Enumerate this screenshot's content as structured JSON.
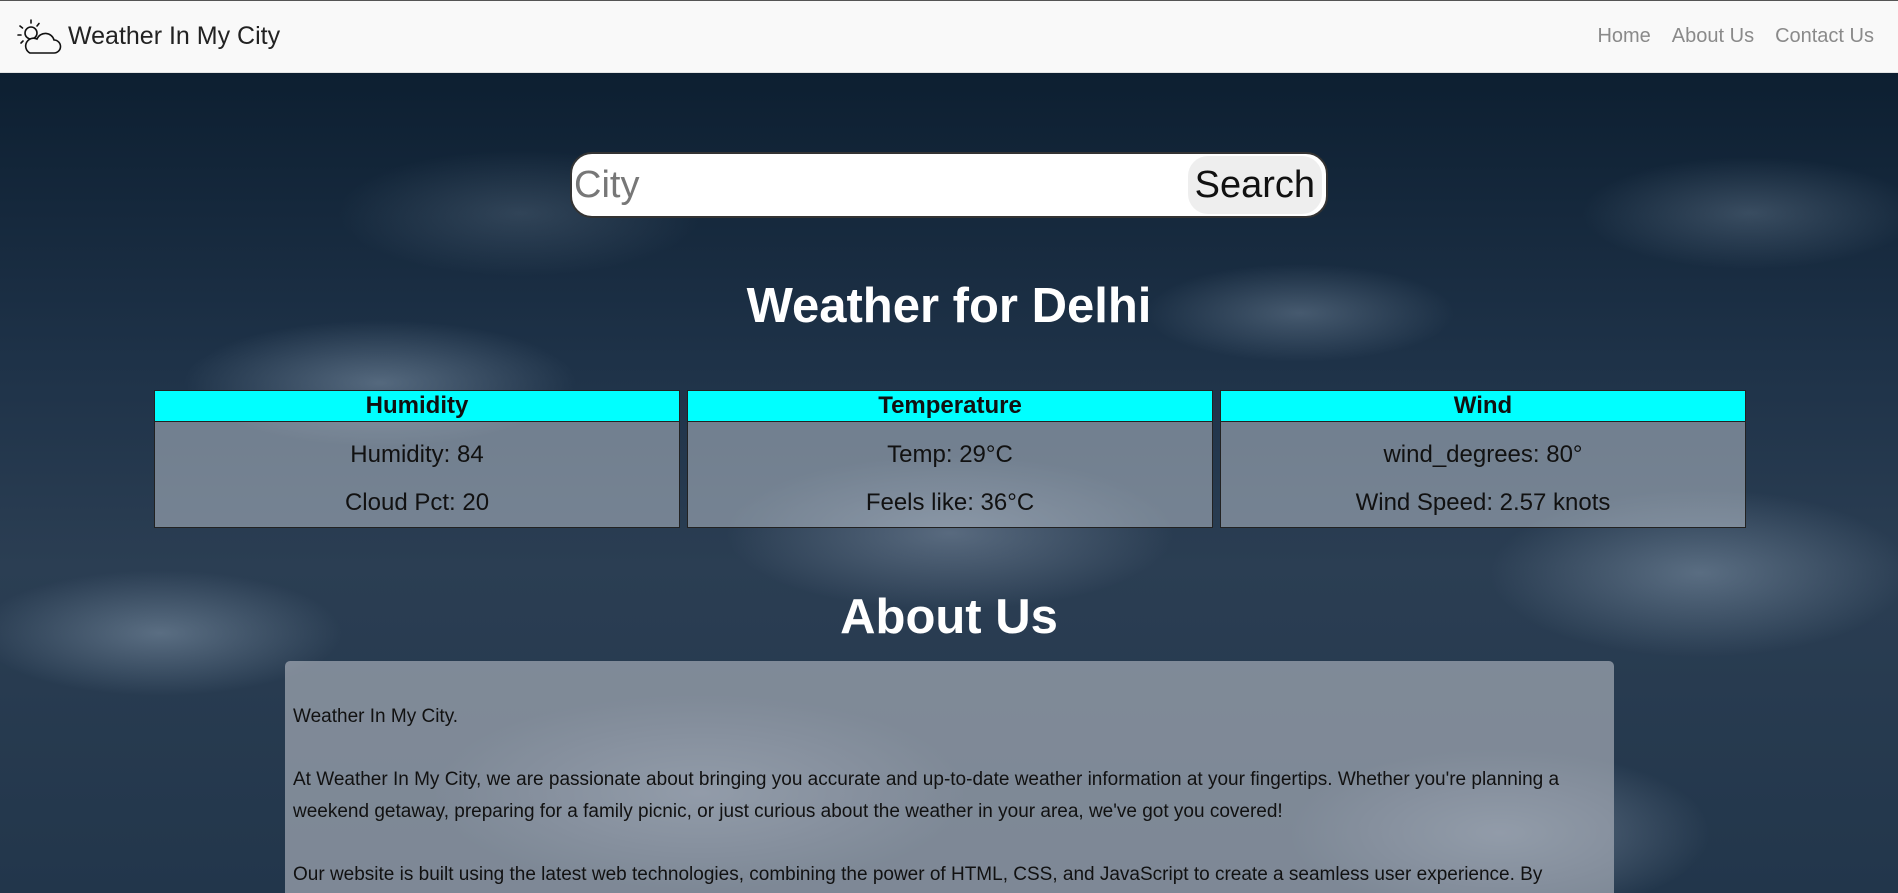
{
  "navbar": {
    "brand": "Weather In My City",
    "brand_icon": "cloud-sun-icon",
    "links": [
      "Home",
      "About Us",
      "Contact Us"
    ]
  },
  "search": {
    "placeholder": "City",
    "value": "",
    "button_label": "Search"
  },
  "weather": {
    "title": "Weather for Delhi",
    "cards": [
      {
        "header": "Humidity",
        "line1": "Humidity: 84",
        "line2": "Cloud Pct: 20"
      },
      {
        "header": "Temperature",
        "line1": "Temp: 29°C",
        "line2": "Feels like: 36°C"
      },
      {
        "header": "Wind",
        "line1": "wind_degrees: 80°",
        "line2": "Wind Speed: 2.57 knots"
      }
    ]
  },
  "about": {
    "title": "About Us",
    "paragraphs": [
      "Weather In My City.",
      "At Weather In My City, we are passionate about bringing you accurate and up-to-date weather information at your fingertips. Whether you're planning a weekend getaway, preparing for a family picnic, or just curious about the weather in your area, we've got you covered!",
      "Our website is built using the latest web technologies, combining the power of HTML, CSS, and JavaScript to create a seamless user experience. By"
    ]
  },
  "colors": {
    "card_header": "#00ffff",
    "navbar_bg": "#f9f9f9",
    "nav_link": "#8a8a8a"
  }
}
